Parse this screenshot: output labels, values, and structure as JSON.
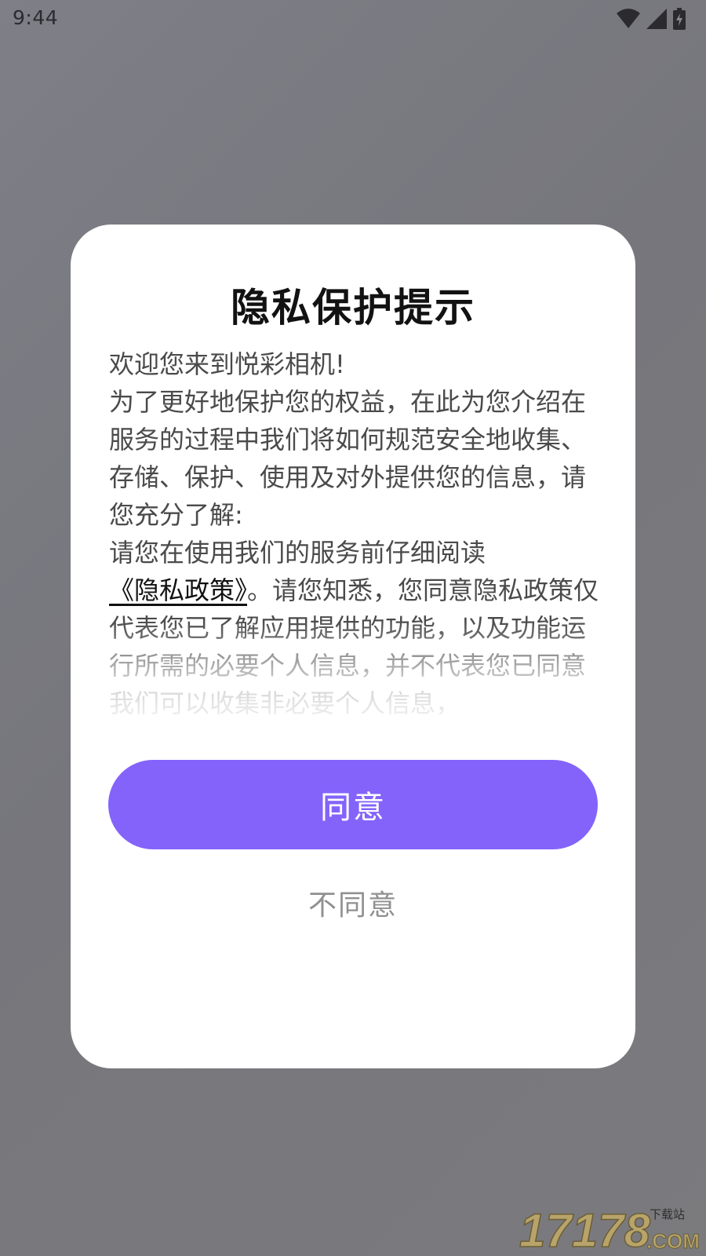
{
  "status_bar": {
    "time": "9:44",
    "icons": [
      "wifi-icon",
      "cell-signal-icon",
      "battery-charging-icon"
    ]
  },
  "dialog": {
    "title": "隐私保护提示",
    "paragraphs": {
      "welcome": "欢迎您来到悦彩相机!",
      "intro": "为了更好地保护您的权益，在此为您介绍在服务的过程中我们将如何规范安全地收集、存储、保护、使用及对外提供您的信息，请您充分了解:",
      "read_prompt": "请您在使用我们的服务前仔细阅读",
      "policy_link": "《隐私政策》",
      "consent_text": "。请您知悉，您同意隐私政策仅代表您已了解应用提供的功能，以及功能运行所需的必要个人信息，并不代表您已同意我们可以收集非必要个人信息，"
    },
    "agree_label": "同意",
    "disagree_label": "不同意"
  },
  "watermark": {
    "number": "17178",
    "tag": "下载站",
    "domain": ".COM"
  },
  "colors": {
    "accent": "#8463fb",
    "backdrop": "#78787e",
    "dialog_bg": "#ffffff",
    "secondary_text": "#909090"
  }
}
